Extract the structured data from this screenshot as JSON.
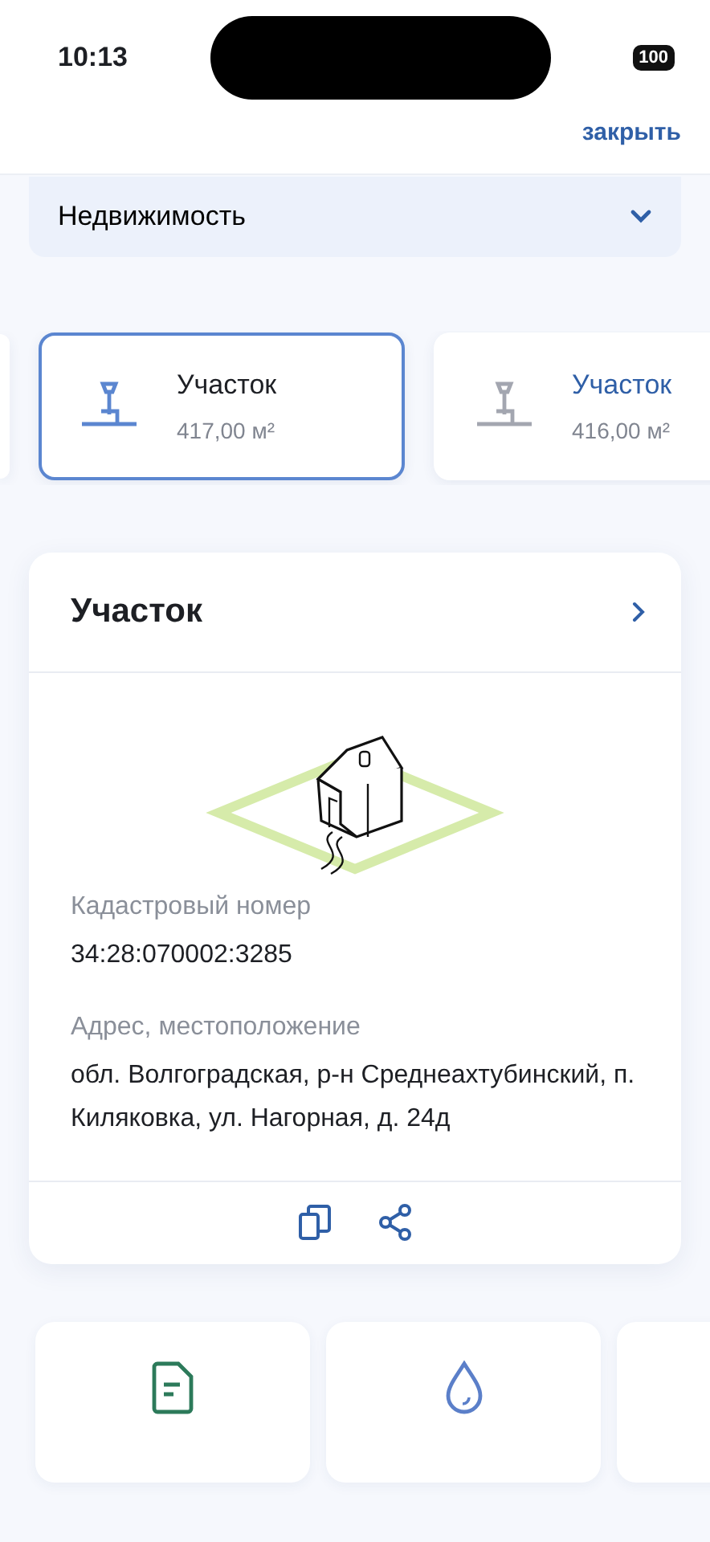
{
  "status_bar": {
    "time": "10:13",
    "battery": "100"
  },
  "header": {
    "close_link": "закрыть"
  },
  "category_select": {
    "value": "Недвижимость"
  },
  "properties": [
    {
      "title": "Участок",
      "area": "417,00 м²",
      "selected": true
    },
    {
      "title": "Участок",
      "area": "416,00 м²",
      "selected": false
    }
  ],
  "detail_card": {
    "title": "Участок",
    "fields": [
      {
        "label": "Кадастровый номер",
        "value": "34:28:070002:3285"
      },
      {
        "label": "Адрес, местоположение",
        "value": "обл. Волгоградская, р-н Среднеахтубинский, п. Киляковка, ул. Нагорная, д. 24д"
      }
    ]
  },
  "services": [
    {
      "kind": "document"
    },
    {
      "kind": "water"
    },
    {
      "kind": "other"
    }
  ]
}
